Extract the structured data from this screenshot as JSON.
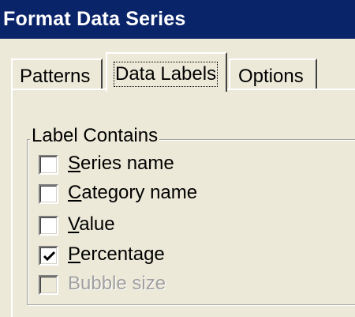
{
  "window": {
    "title": "Format Data Series"
  },
  "tabs": [
    {
      "label": "Patterns",
      "active": false
    },
    {
      "label": "Data Labels",
      "active": true
    },
    {
      "label": "Options",
      "active": false
    }
  ],
  "group": {
    "legend": "Label Contains",
    "checkboxes": [
      {
        "mnemonic": "S",
        "rest": "eries name",
        "checked": false,
        "enabled": true
      },
      {
        "mnemonic": "C",
        "rest": "ategory name",
        "checked": false,
        "enabled": true
      },
      {
        "mnemonic": "V",
        "rest": "alue",
        "checked": false,
        "enabled": true
      },
      {
        "mnemonic": "P",
        "rest": "ercentage",
        "checked": true,
        "enabled": true
      },
      {
        "label": "Bubble size",
        "checked": false,
        "enabled": false
      }
    ]
  },
  "colors": {
    "titlebar": "#0a246a",
    "face": "#ece9d8",
    "disabled_text": "#a0a0a0"
  },
  "icons": {
    "check": "checkmark-icon"
  }
}
